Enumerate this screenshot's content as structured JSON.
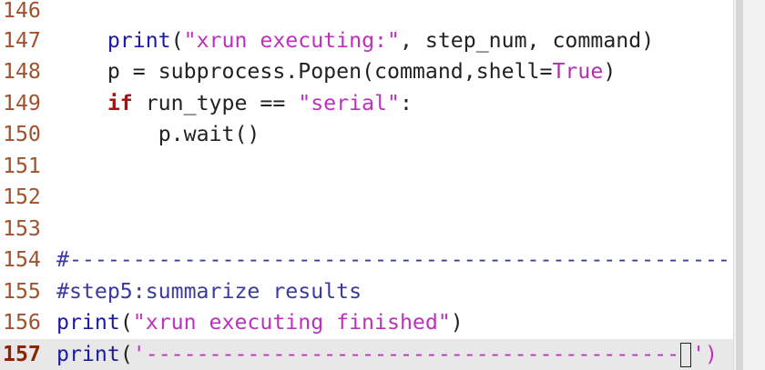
{
  "editor": {
    "lines": [
      {
        "num": "146",
        "code": ""
      },
      {
        "num": "147",
        "indent": "    ",
        "func": "print",
        "open": "(",
        "str": "\"xrun executing:\"",
        "rest": ", step_num, command)"
      },
      {
        "num": "148",
        "indent": "    ",
        "pre": "p = ",
        "func": "subprocess.Popen",
        "mid": "(command,shell=",
        "const": "True",
        "close": ")"
      },
      {
        "num": "149",
        "indent": "    ",
        "kw": "if",
        "pre": " run_type == ",
        "str": "\"serial\"",
        "close": ":"
      },
      {
        "num": "150",
        "indent": "        ",
        "plain": "p.wait()"
      },
      {
        "num": "151",
        "code": ""
      },
      {
        "num": "152",
        "code": ""
      },
      {
        "num": "153",
        "code": ""
      },
      {
        "num": "154",
        "comment": "#------------------------------------------------------------"
      },
      {
        "num": "155",
        "comment": "#step5:summarize results"
      },
      {
        "num": "156",
        "func": "print",
        "open": "(",
        "str": "\"xrun executing finished\"",
        "close": ")"
      },
      {
        "num": "157",
        "func": "print",
        "open": "(",
        "str": "'------------------------------------------",
        "tail": "')"
      }
    ],
    "current_line": "157"
  },
  "colors": {
    "line_number": "#a0522d",
    "keyword": "#a31515",
    "string": "#c030c0",
    "function": "#1a1aa6",
    "comment": "#3a3aa0",
    "current_line_bg": "#e8e8e8"
  }
}
